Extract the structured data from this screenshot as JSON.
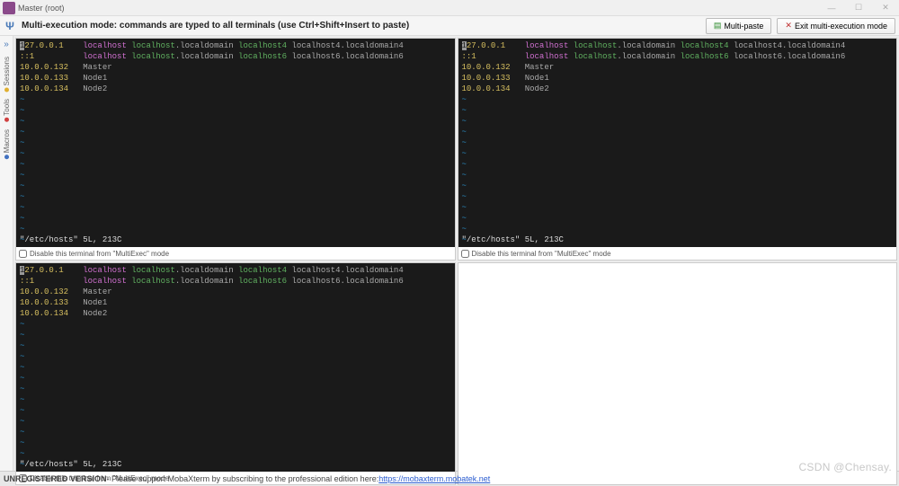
{
  "window": {
    "title": "Master (root)"
  },
  "toolbar": {
    "mode_text": "Multi-execution mode: commands are typed to all terminals (use Ctrl+Shift+Insert to paste)",
    "multipaste_label": "Multi-paste",
    "exit_label": "Exit multi-execution mode"
  },
  "sidebar": {
    "items": [
      "Sessions",
      "Tools",
      "Macros"
    ]
  },
  "hosts_file": {
    "lines": [
      {
        "ip": "127.0.0.1",
        "rest": [
          "localhost",
          "localhost",
          "localdomain",
          "localhost4",
          "localhost4.localdomain4"
        ],
        "hl_first": true
      },
      {
        "ip": "::1",
        "rest": [
          "localhost",
          "localhost",
          "localdomain",
          "localhost6",
          "localhost6.localdomain6"
        ]
      },
      {
        "ip": "10.0.0.132",
        "host": "Master"
      },
      {
        "ip": "10.0.0.133",
        "host": "Node1"
      },
      {
        "ip": "10.0.0.134",
        "host": "Node2"
      }
    ],
    "status": "\"/etc/hosts\" 5L, 213C"
  },
  "term_footer": {
    "disable_label": "Disable this terminal from \"MultiExec\" mode"
  },
  "bottom": {
    "unregistered": "UNREGISTERED VERSION",
    "msg": " - Please support MobaXterm by subscribing to the professional edition here: ",
    "link": "https://mobaxterm.mobatek.net"
  },
  "watermark": "CSDN @Chensay."
}
